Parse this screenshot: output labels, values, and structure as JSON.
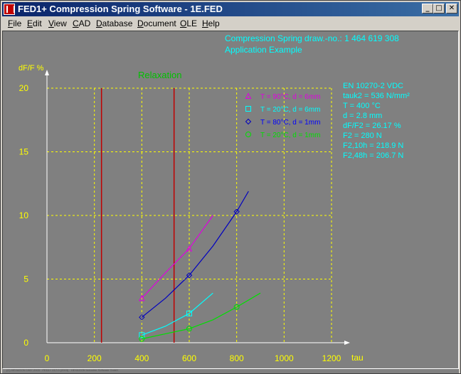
{
  "window": {
    "title": "FED1+   Compression Spring Software  -  1E.FED",
    "controls": {
      "minimize": "_",
      "maximize": "□",
      "close": "✕"
    }
  },
  "menu": [
    {
      "label": "File",
      "mnemonic": "F",
      "rest": "ile"
    },
    {
      "label": "Edit",
      "mnemonic": "E",
      "rest": "dit"
    },
    {
      "label": "View",
      "mnemonic": "V",
      "rest": "iew"
    },
    {
      "label": "CAD",
      "mnemonic": "C",
      "rest": "AD"
    },
    {
      "label": "Database",
      "mnemonic": "D",
      "rest": "atabase"
    },
    {
      "label": "Document",
      "mnemonic": "D",
      "rest": "ocument"
    },
    {
      "label": "OLE",
      "mnemonic": "O",
      "rest": "LE"
    },
    {
      "label": "Help",
      "mnemonic": "H",
      "rest": "elp"
    }
  ],
  "header": {
    "line1": "Compression Spring   draw.-no.: 1 464 619 308",
    "line2": "Application Example"
  },
  "info_panel": [
    "EN 10270-2 VDC",
    "tauk2 = 536 N/mm²",
    "T = 400 °C",
    "d = 2.8 mm",
    "dF/F2 = 26.17 %",
    "F2 = 280 N",
    "F2,10h = 218.9 N",
    "F2,48h = 206.7 N"
  ],
  "status_text": "(C) HEXAGON 1987-2003 · FED1+ V17.0 (2003) · HEXAGON Industrie-Software GmbH",
  "colors": {
    "background": "#808080",
    "grid": "#ffff00",
    "axis": "#ffffff",
    "title": "#00c000",
    "info": "#00ffff",
    "marker_lines": "#c00000"
  },
  "chart_data": {
    "type": "line",
    "title": "Relaxation",
    "xlabel": "tau",
    "ylabel": "dF/F %",
    "xlim": [
      0,
      1200
    ],
    "ylim": [
      0,
      20
    ],
    "x_ticks": [
      0,
      200,
      400,
      600,
      800,
      1000,
      1200
    ],
    "y_ticks": [
      0,
      5,
      10,
      15,
      20
    ],
    "grid": true,
    "legend_position": "top-right",
    "vertical_markers": [
      230,
      536
    ],
    "series": [
      {
        "name": "T = 90°C,  d = 6mm",
        "marker": "triangle",
        "color": "#e000e0",
        "label_color": "#e000e0",
        "x": [
          400,
          500,
          600,
          700
        ],
        "y": [
          3.5,
          5.5,
          7.4,
          10.0
        ],
        "marker_x": [
          400,
          600
        ],
        "marker_y": [
          3.5,
          7.4
        ]
      },
      {
        "name": "T = 20°C,  d = 6mm",
        "marker": "square",
        "color": "#00ffff",
        "label_color": "#00ffff",
        "x": [
          400,
          500,
          600,
          700
        ],
        "y": [
          0.6,
          1.3,
          2.3,
          3.9
        ],
        "marker_x": [
          400,
          600
        ],
        "marker_y": [
          0.6,
          2.3
        ]
      },
      {
        "name": "T = 80°C,  d = 1mm",
        "marker": "diamond",
        "color": "#0000c0",
        "label_color": "#0000ff",
        "x": [
          400,
          500,
          600,
          700,
          800,
          850
        ],
        "y": [
          2.0,
          3.5,
          5.3,
          7.6,
          10.3,
          11.9
        ],
        "marker_x": [
          400,
          600,
          800
        ],
        "marker_y": [
          2.0,
          5.3,
          10.3
        ]
      },
      {
        "name": "T = 20°C,  d = 1mm",
        "marker": "circle",
        "color": "#00e000",
        "label_color": "#00e000",
        "x": [
          400,
          500,
          600,
          700,
          800,
          900
        ],
        "y": [
          0.3,
          0.7,
          1.1,
          1.8,
          2.8,
          3.9
        ],
        "marker_x": [
          400,
          600,
          800
        ],
        "marker_y": [
          0.3,
          1.1,
          2.8
        ]
      }
    ]
  }
}
